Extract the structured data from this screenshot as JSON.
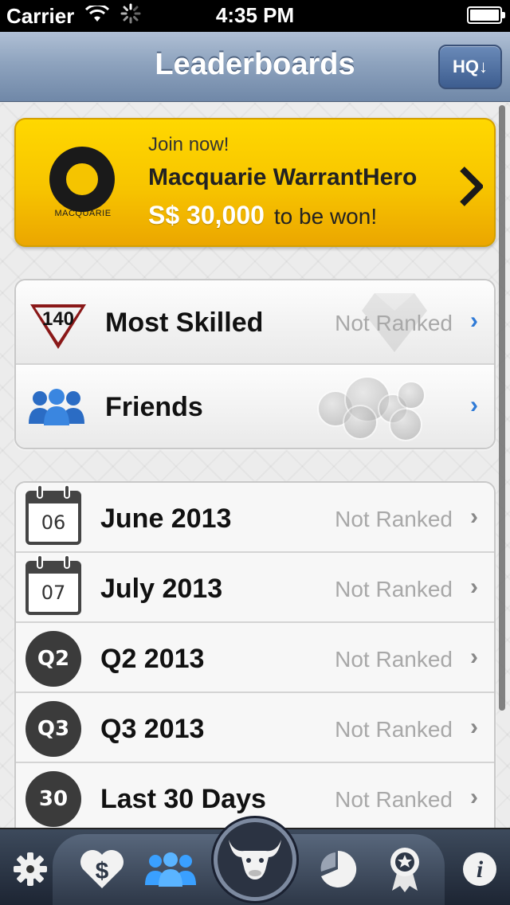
{
  "status_bar": {
    "carrier": "Carrier",
    "time": "4:35 PM",
    "battery_level": 1.0
  },
  "nav": {
    "title": "Leaderboards",
    "hq_button": "HQ↓"
  },
  "banner": {
    "join": "Join now!",
    "title": "Macquarie WarrantHero",
    "amount": "S$ 30,000",
    "suffix": "to be won!",
    "logo_text": "MACQUARIE"
  },
  "special_boards": [
    {
      "label": "Most Skilled",
      "status": "Not Ranked",
      "icon": "skill-badge-icon",
      "badge": "140"
    },
    {
      "label": "Friends",
      "status": "",
      "icon": "friends-icon"
    }
  ],
  "period_boards": [
    {
      "label": "June 2013",
      "status": "Not Ranked",
      "icon": "calendar-icon",
      "icon_text": "06"
    },
    {
      "label": "July 2013",
      "status": "Not Ranked",
      "icon": "calendar-icon",
      "icon_text": "07"
    },
    {
      "label": "Q2 2013",
      "status": "Not Ranked",
      "icon": "quarter-icon",
      "icon_text": "Q2"
    },
    {
      "label": "Q3 2013",
      "status": "Not Ranked",
      "icon": "quarter-icon",
      "icon_text": "Q3"
    },
    {
      "label": "Last 30 Days",
      "status": "Not Ranked",
      "icon": "days-icon",
      "icon_text": "30"
    }
  ],
  "tabs": [
    {
      "name": "settings",
      "icon": "gear-icon"
    },
    {
      "name": "portfolio",
      "icon": "heart-dollar-icon"
    },
    {
      "name": "leaderboards",
      "icon": "people-icon"
    },
    {
      "name": "home",
      "icon": "bull-icon"
    },
    {
      "name": "charts",
      "icon": "pie-chart-icon"
    },
    {
      "name": "awards",
      "icon": "award-icon"
    },
    {
      "name": "info",
      "icon": "info-icon"
    }
  ]
}
